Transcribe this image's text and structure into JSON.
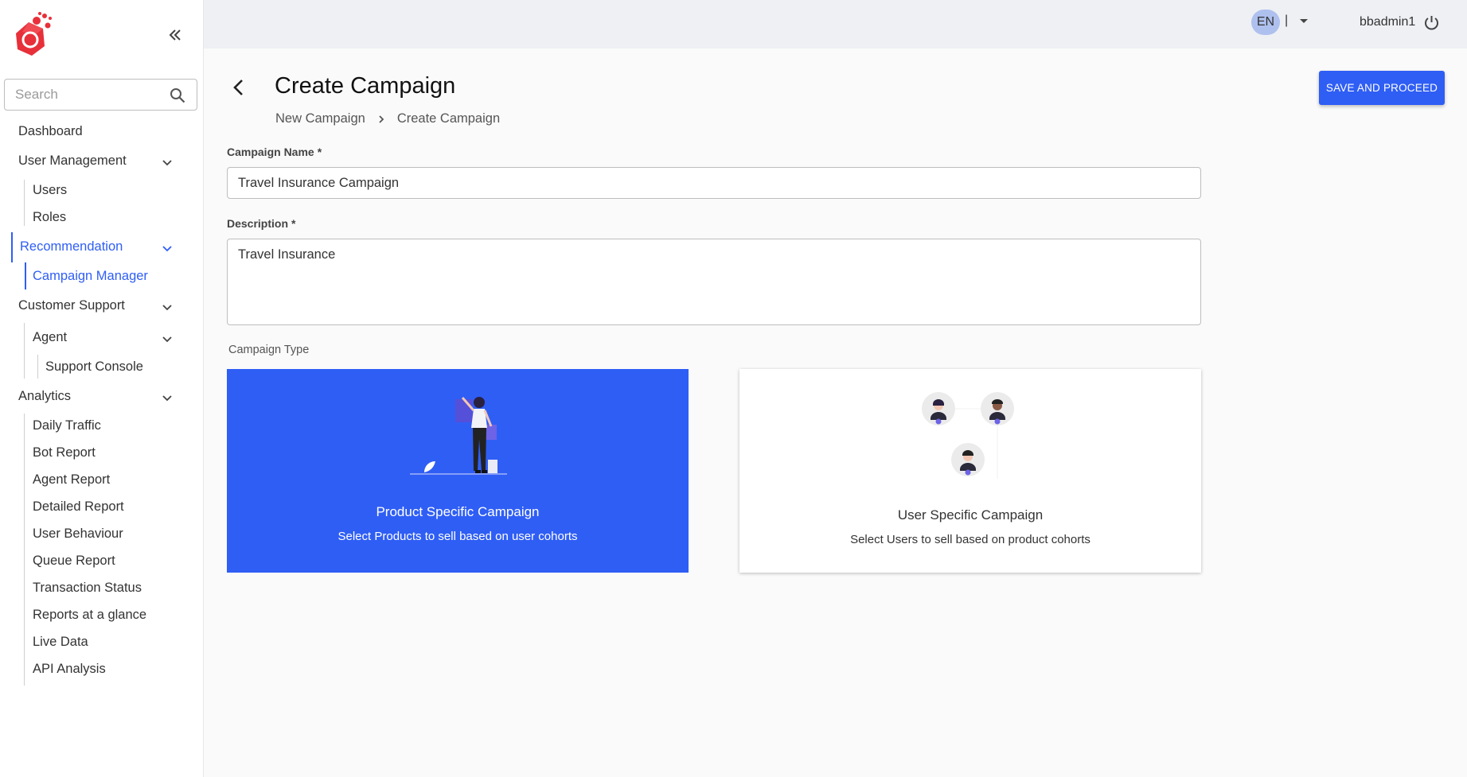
{
  "sidebar": {
    "search_placeholder": "Search",
    "items": [
      {
        "label": "Dashboard"
      },
      {
        "label": "User Management"
      },
      {
        "label": "Users"
      },
      {
        "label": "Roles"
      },
      {
        "label": "Recommendation"
      },
      {
        "label": "Campaign Manager"
      },
      {
        "label": "Customer Support"
      },
      {
        "label": "Agent"
      },
      {
        "label": "Support Console"
      },
      {
        "label": "Analytics"
      },
      {
        "label": "Daily Traffic"
      },
      {
        "label": "Bot Report"
      },
      {
        "label": "Agent Report"
      },
      {
        "label": "Detailed Report"
      },
      {
        "label": "User Behaviour"
      },
      {
        "label": "Queue Report"
      },
      {
        "label": "Transaction Status"
      },
      {
        "label": "Reports at a glance"
      },
      {
        "label": "Live Data"
      },
      {
        "label": "API Analysis"
      }
    ]
  },
  "header": {
    "language": "EN",
    "separator": "|",
    "username": "bbadmin1"
  },
  "page": {
    "title": "Create Campaign",
    "breadcrumb": [
      "New Campaign",
      "Create Campaign"
    ],
    "save_label": "SAVE AND PROCEED"
  },
  "form": {
    "name_label": "Campaign Name",
    "name_value": "Travel Insurance Campaign",
    "description_label": "Description",
    "description_value": "Travel Insurance",
    "required_mark": "*",
    "type_label": "Campaign Type"
  },
  "cards": [
    {
      "title": "Product Specific Campaign",
      "description": "Select Products to sell based on user cohorts",
      "selected": true
    },
    {
      "title": "User Specific Campaign",
      "description": "Select Users to sell based on product cohorts",
      "selected": false
    }
  ],
  "colors": {
    "accent": "#2f5ef5",
    "topbar": "#eef0f4",
    "badge": "#aec0ee",
    "logo": "#e8303a"
  }
}
